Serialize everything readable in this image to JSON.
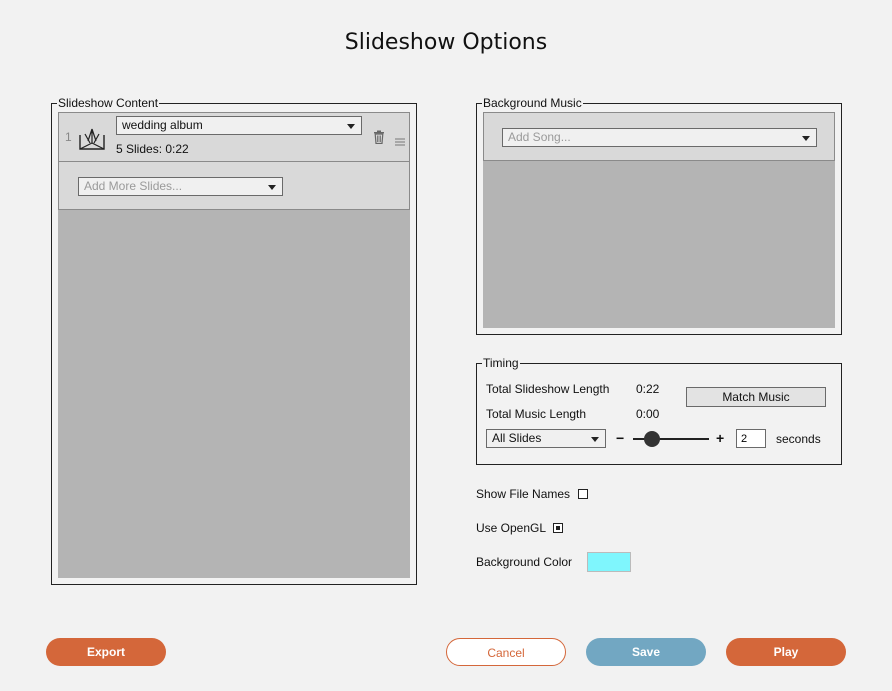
{
  "title": "Slideshow Options",
  "content": {
    "legend": "Slideshow Content",
    "items": [
      {
        "index": "1",
        "album": "wedding album",
        "summary": "5 Slides: 0:22"
      }
    ],
    "add_more_placeholder": "Add More Slides..."
  },
  "music": {
    "legend": "Background Music",
    "add_song_placeholder": "Add Song..."
  },
  "timing": {
    "legend": "Timing",
    "total_slideshow_label": "Total Slideshow Length",
    "total_slideshow_value": "0:22",
    "total_music_label": "Total Music Length",
    "total_music_value": "0:00",
    "match_music_label": "Match Music",
    "scope_select": "All Slides",
    "minus": "−",
    "plus": "+",
    "seconds_value": "2",
    "seconds_label": "seconds",
    "slider_fraction": 0.25
  },
  "options": {
    "show_file_names_label": "Show File Names",
    "show_file_names_checked": false,
    "use_opengl_label": "Use OpenGL",
    "use_opengl_checked": true,
    "background_color_label": "Background Color",
    "background_color": "#7ff6fd"
  },
  "buttons": {
    "export": "Export",
    "cancel": "Cancel",
    "save": "Save",
    "play": "Play"
  },
  "colors": {
    "orange": "#d4673a",
    "blue": "#72a7c2"
  }
}
